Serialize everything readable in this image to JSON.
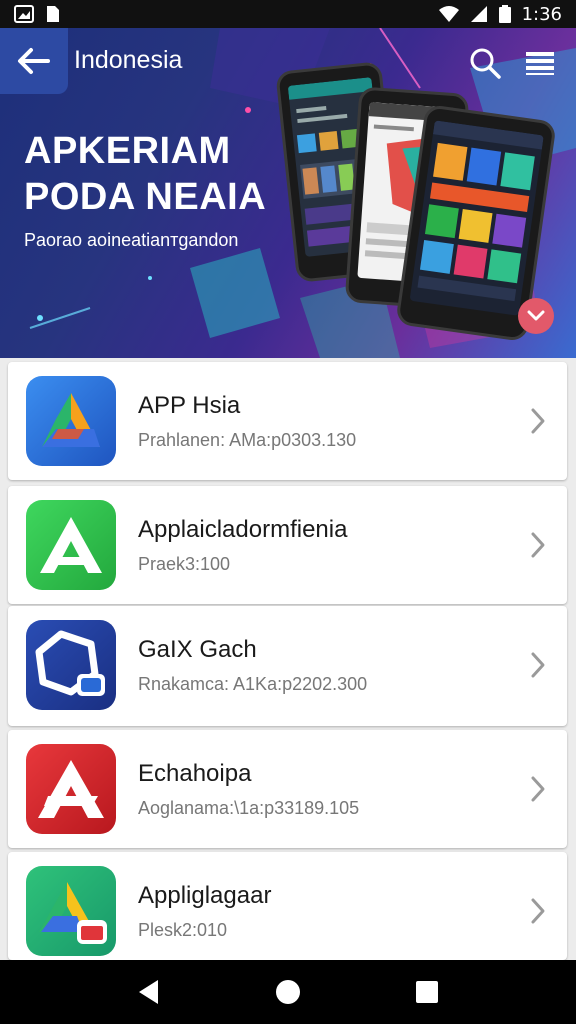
{
  "status_bar": {
    "time": "1:36"
  },
  "header": {
    "title": "Indonesia"
  },
  "banner": {
    "line1": "APKERIAM",
    "line2": "PODA NEAIA",
    "subtitle": "Paorao aoineatianтgandon"
  },
  "apps": [
    {
      "name": "APP Hsia",
      "meta": "Prahlanen: AMa:p0303.130",
      "color": "#2f6fd6"
    },
    {
      "name": "Applaicladormfienia",
      "meta": "Praek3:100",
      "color": "#2cc04a"
    },
    {
      "name": "GaIX Gach",
      "meta": "Rnakamca: A1Ka:p2202.300",
      "color": "#1f3f9e"
    },
    {
      "name": "Echahoipa",
      "meta": "Aoglanama:\\1a:p33189.105",
      "color": "#d9262c"
    },
    {
      "name": "Appliglagaar",
      "meta": "Plesk2:010",
      "color": "#22b06a"
    }
  ]
}
